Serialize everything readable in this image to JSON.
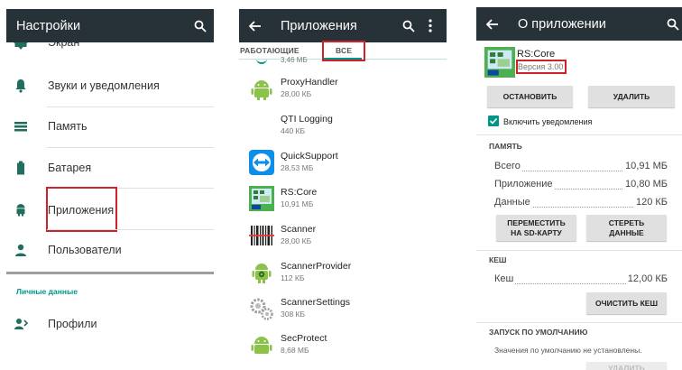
{
  "panel1": {
    "title": "Настройки",
    "items": [
      {
        "label": "Экран",
        "icon": "brightness-icon"
      },
      {
        "label": "Звуки и уведомления",
        "icon": "bell-icon"
      },
      {
        "label": "Память",
        "icon": "storage-icon"
      },
      {
        "label": "Батарея",
        "icon": "battery-icon"
      },
      {
        "label": "Приложения",
        "icon": "android-icon"
      },
      {
        "label": "Пользователи",
        "icon": "person-icon"
      }
    ],
    "section_label": "Личные данные",
    "profiles_label": "Профили"
  },
  "panel2": {
    "title": "Приложения",
    "tabs": [
      "РАБОТАЮЩИЕ",
      "ВСЕ"
    ],
    "partial_size": "3,46 МБ",
    "apps": [
      {
        "name": "ProxyHandler",
        "size": "28,00 КБ",
        "icon": "android-icon"
      },
      {
        "name": "QTI Logging",
        "size": "440 КБ",
        "icon": "blank-icon"
      },
      {
        "name": "QuickSupport",
        "size": "28,53 МБ",
        "icon": "teamviewer-icon"
      },
      {
        "name": "RS:Core",
        "size": "10,91 МБ",
        "icon": "rscore-icon"
      },
      {
        "name": "Scanner",
        "size": "28,00 КБ",
        "icon": "barcode-icon"
      },
      {
        "name": "ScannerProvider",
        "size": "112 КБ",
        "icon": "android-gear-icon"
      },
      {
        "name": "ScannerSettings",
        "size": "308 КБ",
        "icon": "gears-icon"
      },
      {
        "name": "SecProtect",
        "size": "8,68 МБ",
        "icon": "android-icon"
      }
    ]
  },
  "panel3": {
    "title": "О приложении",
    "app_name": "RS:Core",
    "version": "Версия 3.00",
    "stop_button": "ОСТАНОВИТЬ",
    "delete_button": "УДАЛИТЬ",
    "notifications_label": "Включить уведомления",
    "memory_section": "ПАМЯТЬ",
    "memory_rows": [
      {
        "label": "Всего",
        "value": "10,91 МБ"
      },
      {
        "label": "Приложение",
        "value": "10,80 МБ"
      },
      {
        "label": "Данные",
        "value": "120 КБ"
      }
    ],
    "move_button_line1": "ПЕРЕМЕСТИТЬ",
    "move_button_line2": "НА SD-КАРТУ",
    "clear_data_line1": "СТЕРЕТЬ",
    "clear_data_line2": "ДАННЫЕ",
    "cache_section": "КЕШ",
    "cache_label": "Кеш",
    "cache_value": "12,00 КБ",
    "clear_cache_button": "ОЧИСТИТЬ КЕШ",
    "default_section": "ЗАПУСК ПО УМОЛЧАНИЮ",
    "default_text": "Значения по умолчанию не установлены.",
    "bottom_button": "УДАЛИТЬ"
  },
  "colors": {
    "toolbar": "#263238",
    "accent_teal": "#009688",
    "highlight_red": "#d0202a",
    "android_green": "#8bc34a"
  }
}
